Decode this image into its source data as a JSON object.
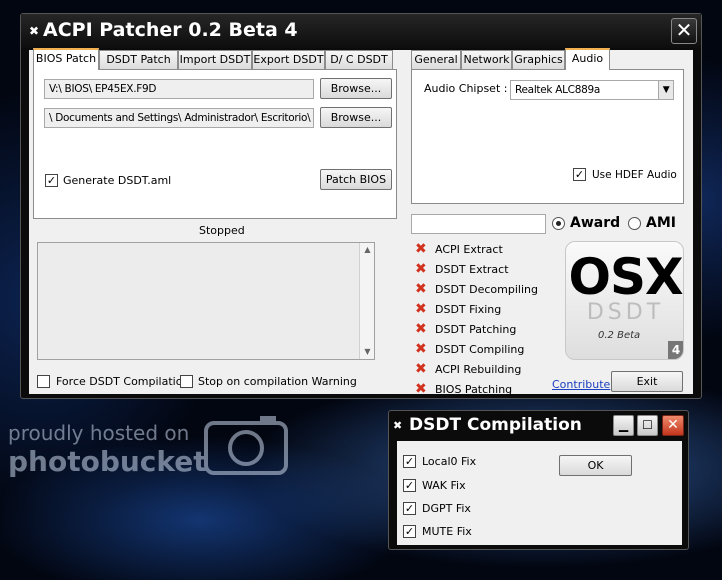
{
  "main_window": {
    "title": "ACPI Patcher 0.2 Beta 4",
    "close_glyph": "✕",
    "left_tabs": [
      "BIOS Patch",
      "DSDT Patch",
      "Import DSDT",
      "Export DSDT",
      "D/ C DSDT"
    ],
    "bios_path": "V:\\ BIOS\\ EP45EX.F9D",
    "dsdt_path": "\\ Documents and Settings\\ Administrador\\ Escritorio\\ dsdt",
    "browse_label": "Browse...",
    "generate_dsdt_label": "Generate DSDT.aml",
    "generate_dsdt_checked": true,
    "patch_bios_label": "Patch BIOS",
    "status_text": "Stopped",
    "right_tabs": [
      "General",
      "Network",
      "Graphics",
      "Audio"
    ],
    "audio_chipset_label": "Audio Chipset :",
    "audio_chipset_value": "Realtek ALC889a",
    "use_hdef_label": "Use HDEF Audio",
    "use_hdef_checked": true,
    "bios_type": {
      "options": [
        "Award",
        "AMI"
      ],
      "selected": "Award"
    },
    "steps": [
      "ACPI Extract",
      "DSDT Extract",
      "DSDT Decompiling",
      "DSDT Fixing",
      "DSDT Patching",
      "DSDT Compiling",
      "ACPI Rebuilding",
      "BIOS Patching"
    ],
    "force_compilation_label": "Force DSDT Compilation",
    "stop_on_warning_label": "Stop on compilation Warning",
    "logo": {
      "big": "OSX",
      "sub": "DSDT",
      "version": "0.2 Beta",
      "badge": "4"
    },
    "contribute_label": "Contribute",
    "exit_label": "Exit"
  },
  "dialog": {
    "title": "DSDT Compilation",
    "fixes": [
      {
        "label": "Local0 Fix",
        "checked": true
      },
      {
        "label": "WAK Fix",
        "checked": true
      },
      {
        "label": "DGPT Fix",
        "checked": true
      },
      {
        "label": "MUTE Fix",
        "checked": true
      }
    ],
    "ok_label": "OK"
  },
  "watermark": {
    "line1": "proudly hosted on",
    "line2": "photobucket"
  },
  "colors": {
    "error_mark": "#d0321e",
    "active_tab_accent": "#f3b24f",
    "link": "#1a3fbf"
  }
}
